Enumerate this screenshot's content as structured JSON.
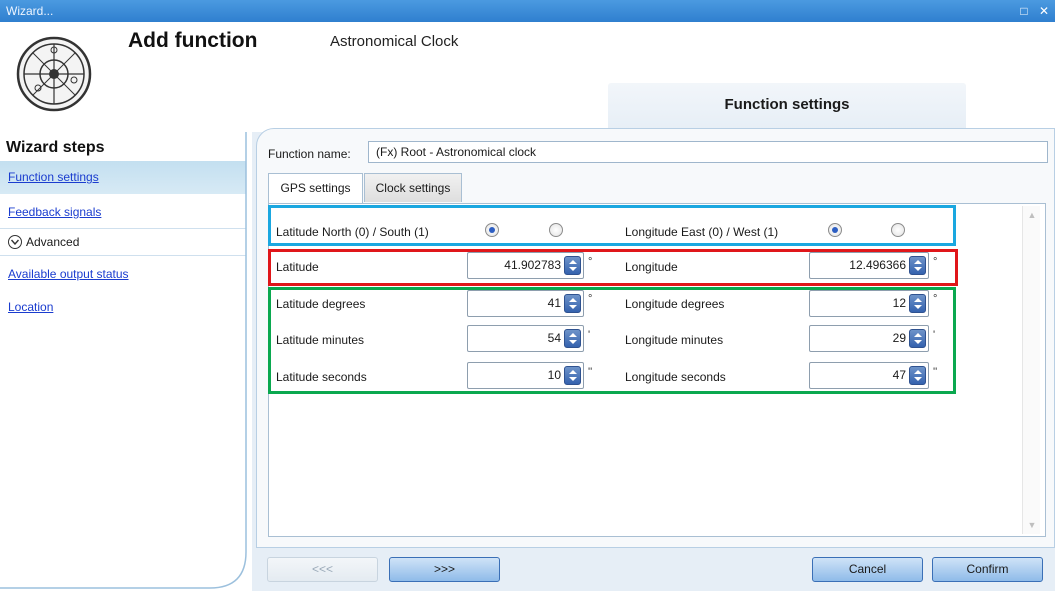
{
  "window": {
    "title": "Wizard..."
  },
  "header": {
    "title": "Add function",
    "subtitle": "Astronomical Clock",
    "section_tab": "Function settings"
  },
  "sidebar": {
    "heading": "Wizard steps",
    "items": [
      {
        "label": "Function settings",
        "active": true
      },
      {
        "label": "Feedback signals",
        "active": false
      },
      {
        "label": "Advanced",
        "type": "expander"
      },
      {
        "label": "Available output status",
        "active": false
      },
      {
        "label": "Location",
        "active": false
      }
    ]
  },
  "form": {
    "function_name_label": "Function name:",
    "function_name_value": "(Fx) Root - Astronomical clock",
    "tabs": [
      {
        "label": "GPS settings",
        "active": true
      },
      {
        "label": "Clock settings",
        "active": false
      }
    ]
  },
  "gps": {
    "lat_ns_label": "Latitude North (0) / South (1)",
    "lat_ns_selected": 0,
    "lon_ew_label": "Longitude East (0) / West (1)",
    "lon_ew_selected": 0,
    "latitude_label": "Latitude",
    "latitude_value": "41.902783",
    "longitude_label": "Longitude",
    "longitude_value": "12.496366",
    "lat_deg_label": "Latitude degrees",
    "lat_deg_value": "41",
    "lat_min_label": "Latitude minutes",
    "lat_min_value": "54",
    "lat_sec_label": "Latitude seconds",
    "lat_sec_value": "10",
    "lon_deg_label": "Longitude degrees",
    "lon_deg_value": "12",
    "lon_min_label": "Longitude minutes",
    "lon_min_value": "29",
    "lon_sec_label": "Longitude seconds",
    "lon_sec_value": "47",
    "unit_deg": "°",
    "unit_min": "'",
    "unit_sec": "''"
  },
  "footer": {
    "prev_label": "<<<",
    "next_label": ">>>",
    "cancel_label": "Cancel",
    "confirm_label": "Confirm"
  },
  "colors": {
    "highlight_radio": "#1aa7e0",
    "highlight_decimal": "#e0161a",
    "highlight_dms": "#0aa84f",
    "link": "#1a3ccf"
  }
}
